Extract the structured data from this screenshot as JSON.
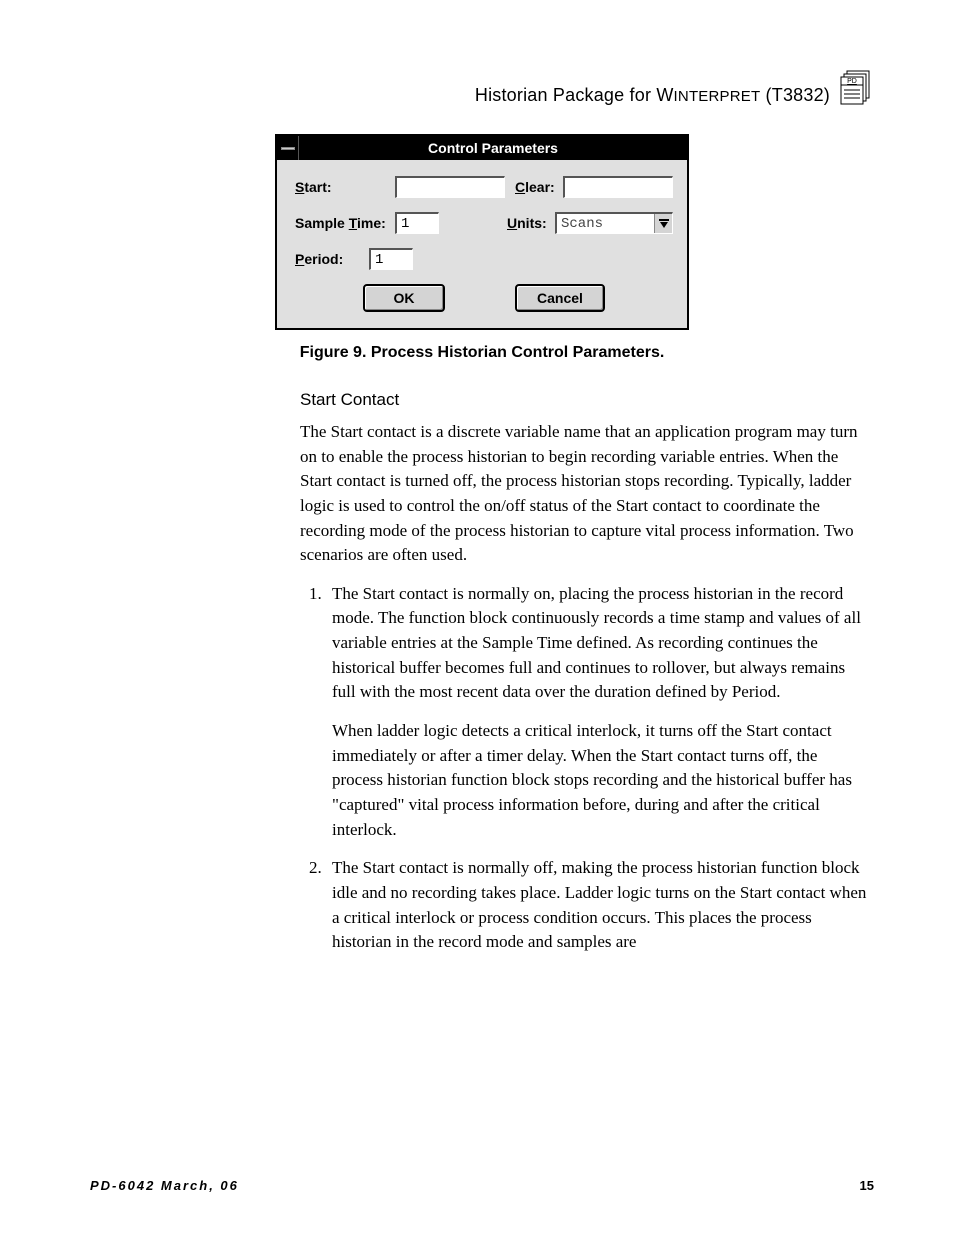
{
  "header": {
    "text_a": "Historian  Package  for W",
    "text_b": "INTERPRET",
    "text_c": " (T3832)",
    "icon_label": "PD"
  },
  "dialog": {
    "title": "Control Parameters",
    "labels": {
      "start_pre": "S",
      "start_post": "tart:",
      "clear_pre": "C",
      "clear_post": "lear:",
      "sample_pre": "Sample ",
      "sample_u": "T",
      "sample_post": "ime:",
      "units_pre": "U",
      "units_post": "nits:",
      "period_pre": "P",
      "period_post": "eriod:"
    },
    "values": {
      "start": "",
      "clear": "",
      "sample_time": "1",
      "units": "Scans",
      "period": "1"
    },
    "buttons": {
      "ok": "OK",
      "cancel": "Cancel"
    }
  },
  "caption": "Figure 9.  Process Historian Control Parameters.",
  "section_head": "Start Contact",
  "para1": "The Start contact is a discrete variable name that an application program may turn on to enable the process historian to begin recording variable entries.  When the Start contact is turned off, the process historian stops recording.  Typically, ladder logic is used to control the on/off status of the Start contact to coordinate the recording mode of the process historian to capture vital process information.  Two scenarios are often used.",
  "list": {
    "item1a": "The Start contact is normally on, placing the process historian in the record mode.  The function block continuously records a time stamp and values of all variable entries at the Sample Time defined.  As recording continues the historical buffer becomes full and continues to rollover, but always remains full with the most recent data over the duration defined by Period.",
    "item1b": "When ladder logic detects a critical interlock, it turns off the Start contact immediately or after a timer delay.  When the Start contact turns off, the process historian function block stops recording and the historical buffer has \"captured\" vital process information before, during and after the critical interlock.",
    "item2": "The Start contact is normally off, making the process historian function block idle and no recording takes place.  Ladder logic turns on the Start contact when a critical interlock or process condition occurs.  This places the process historian in the record mode and samples are"
  },
  "footer": {
    "left": "PD-6042 March, 06",
    "right": "15"
  }
}
